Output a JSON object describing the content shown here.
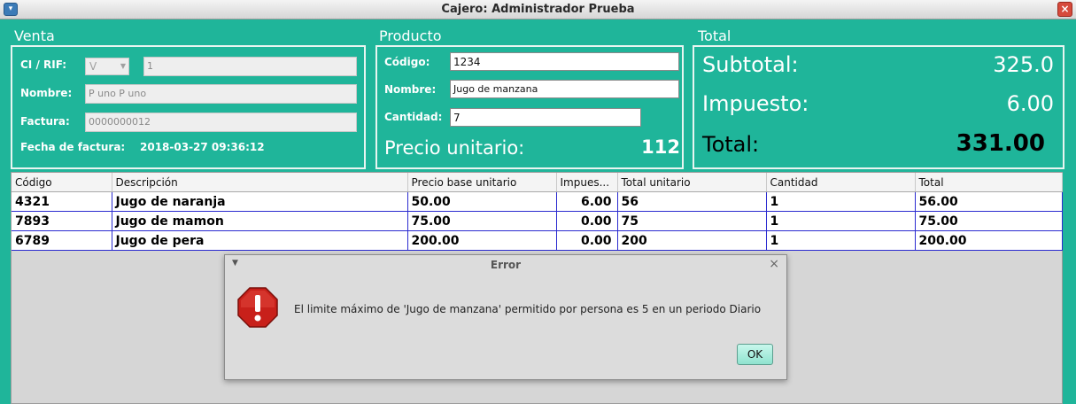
{
  "window": {
    "title": "Cajero: Administrador Prueba"
  },
  "venta": {
    "title": "Venta",
    "ci_label": "CI / RIF:",
    "ci_type": "V",
    "ci_value": "1",
    "nombre_label": "Nombre:",
    "nombre_value": "P uno P uno",
    "factura_label": "Factura:",
    "factura_value": "0000000012",
    "fecha_label": "Fecha de factura:",
    "fecha_value": "2018-03-27 09:36:12"
  },
  "producto": {
    "title": "Producto",
    "codigo_label": "Código:",
    "codigo_value": "1234",
    "nombre_label": "Nombre:",
    "nombre_value": "Jugo de manzana",
    "cantidad_label": "Cantidad:",
    "cantidad_value": "7",
    "precio_label": "Precio unitario:",
    "precio_value": "112"
  },
  "total": {
    "title": "Total",
    "subtotal_label": "Subtotal:",
    "subtotal_value": "325.0",
    "impuesto_label": "Impuesto:",
    "impuesto_value": "6.00",
    "total_label": "Total:",
    "total_value": "331.00"
  },
  "table": {
    "headers": [
      "Código",
      "Descripción",
      "Precio base unitario",
      "Impues...",
      "Total unitario",
      "Cantidad",
      "Total"
    ],
    "rows": [
      [
        "4321",
        "Jugo de naranja",
        "50.00",
        "6.00",
        "56",
        "1",
        "56.00"
      ],
      [
        "7893",
        "Jugo de mamon",
        "75.00",
        "0.00",
        "75",
        "1",
        "75.00"
      ],
      [
        "6789",
        "Jugo de pera",
        "200.00",
        "0.00",
        "200",
        "1",
        "200.00"
      ]
    ]
  },
  "dialog": {
    "title": "Error",
    "message": "El limite máximo de 'Jugo de manzana' permitido por persona es 5 en un periodo Diario",
    "ok_label": "OK",
    "icon": "stop-icon"
  },
  "colors": {
    "background": "#1fb59a",
    "grid_line": "#2b2bd0"
  }
}
